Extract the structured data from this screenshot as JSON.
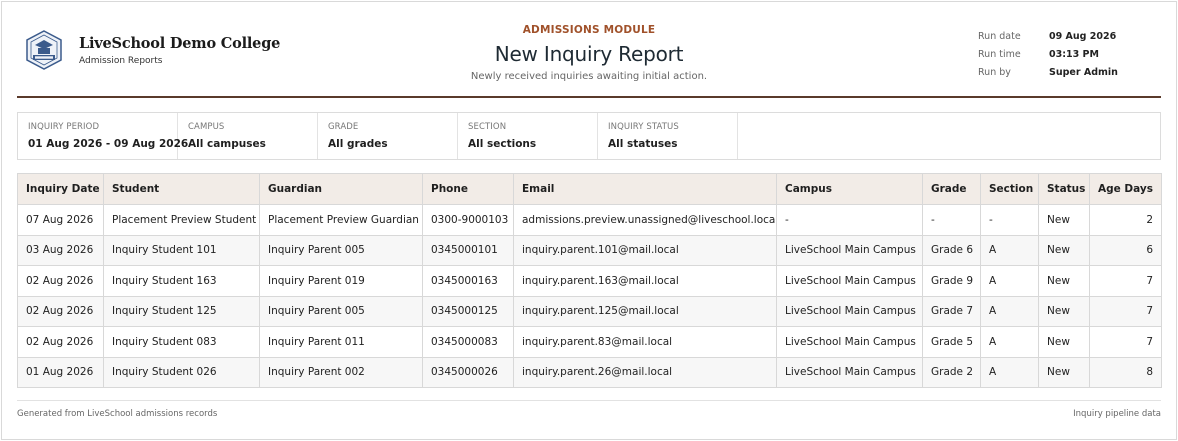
{
  "brand": {
    "college": "LiveSchool Demo College",
    "subtitle": "Admission Reports"
  },
  "header": {
    "module": "ADMISSIONS MODULE",
    "title": "New Inquiry Report",
    "subtitle": "Newly received inquiries awaiting initial action."
  },
  "meta": [
    {
      "label": "Run date",
      "value": "09 Aug 2026"
    },
    {
      "label": "Run time",
      "value": "03:13 PM"
    },
    {
      "label": "Run by",
      "value": "Super Admin"
    }
  ],
  "filters": [
    {
      "label": "INQUIRY PERIOD",
      "value": "01 Aug 2026 - 09 Aug 2026"
    },
    {
      "label": "CAMPUS",
      "value": "All campuses"
    },
    {
      "label": "GRADE",
      "value": "All grades"
    },
    {
      "label": "SECTION",
      "value": "All sections"
    },
    {
      "label": "INQUIRY STATUS",
      "value": "All statuses"
    }
  ],
  "table": {
    "columns": [
      "Inquiry Date",
      "Student",
      "Guardian",
      "Phone",
      "Email",
      "Campus",
      "Grade",
      "Section",
      "Status",
      "Age Days"
    ],
    "rows": [
      [
        "07 Aug 2026",
        "Placement Preview Student",
        "Placement Preview Guardian",
        "0300-9000103",
        "admissions.preview.unassigned@liveschool.local",
        "-",
        "-",
        "-",
        "New",
        "2"
      ],
      [
        "03 Aug 2026",
        "Inquiry Student 101",
        "Inquiry Parent 005",
        "0345000101",
        "inquiry.parent.101@mail.local",
        "LiveSchool Main Campus",
        "Grade 6",
        "A",
        "New",
        "6"
      ],
      [
        "02 Aug 2026",
        "Inquiry Student 163",
        "Inquiry Parent 019",
        "0345000163",
        "inquiry.parent.163@mail.local",
        "LiveSchool Main Campus",
        "Grade 9",
        "A",
        "New",
        "7"
      ],
      [
        "02 Aug 2026",
        "Inquiry Student 125",
        "Inquiry Parent 005",
        "0345000125",
        "inquiry.parent.125@mail.local",
        "LiveSchool Main Campus",
        "Grade 7",
        "A",
        "New",
        "7"
      ],
      [
        "02 Aug 2026",
        "Inquiry Student 083",
        "Inquiry Parent 011",
        "0345000083",
        "inquiry.parent.83@mail.local",
        "LiveSchool Main Campus",
        "Grade 5",
        "A",
        "New",
        "7"
      ],
      [
        "01 Aug 2026",
        "Inquiry Student 026",
        "Inquiry Parent 002",
        "0345000026",
        "inquiry.parent.26@mail.local",
        "LiveSchool Main Campus",
        "Grade 2",
        "A",
        "New",
        "8"
      ]
    ]
  },
  "footer": {
    "left": "Generated from LiveSchool admissions records",
    "right": "Inquiry pipeline data"
  },
  "colors": {
    "accent": "#a0512a",
    "rule": "#5a3a2b",
    "header_bg": "#f2ece7",
    "logo_blue": "#3b5b8c"
  },
  "icons": [
    "college-crest-logo"
  ]
}
